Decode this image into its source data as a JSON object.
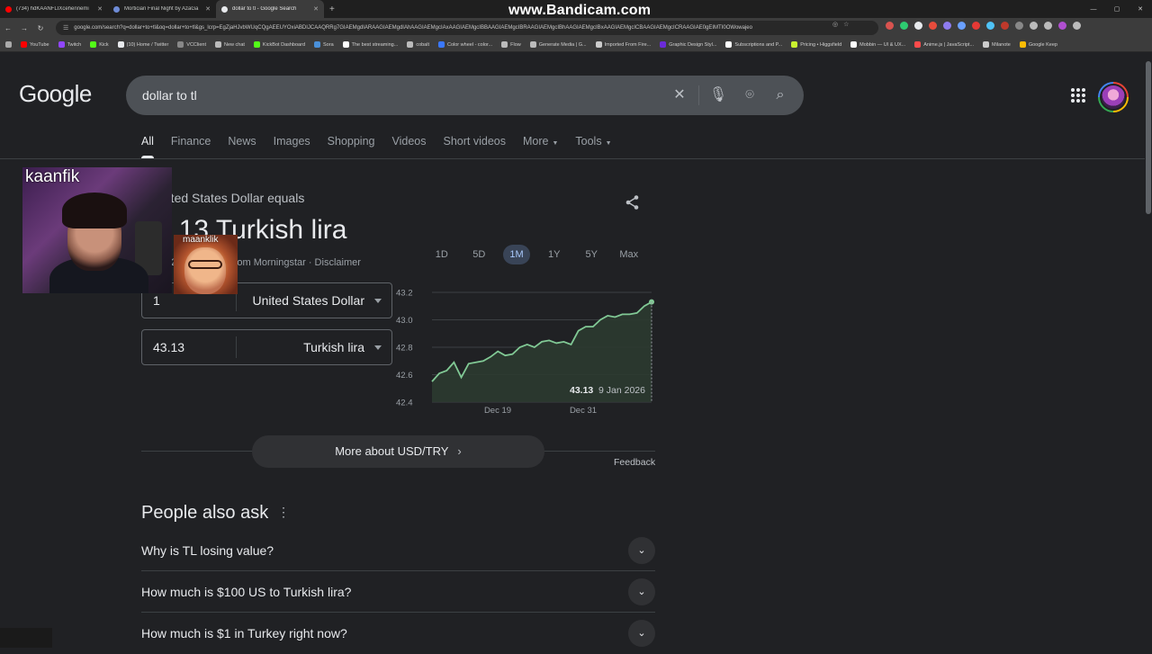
{
  "browser": {
    "tabs": [
      {
        "title": "(734) hdKAANFLIXcehennemi",
        "color": "#ff0000",
        "active": false
      },
      {
        "title": "Mortician Final Night by AzaGa",
        "color": "#6e8bd6",
        "active": false
      },
      {
        "title": "dollar to tl - Google Search",
        "color": "#e8eaed",
        "active": true
      }
    ],
    "new_tab": "+",
    "watermark": "www.Bandicam.com",
    "url": "google.com/search?q=dollar+to+tl&oq=dollar+to+tl&gs_lcrp=EgZjaHJvbWUqCQgAEEUYOxiABDIJCAAQRRg7GIAEMgdIARAAGIAEMgdIAhAAGIAEMgcIAxAAGIAEMgcIBBAAGIAEMgcIBRAAGIAEMgcIBhAAGIAEMgcIBxAAGIAEMgcICBAAGIAEMgcICRAAGIAE0gEIMTI0OWowajeo",
    "bookmarks": [
      {
        "label": "YouTube",
        "color": "#ff0000"
      },
      {
        "label": "Twitch",
        "color": "#9146ff"
      },
      {
        "label": "Kick",
        "color": "#53fc18"
      },
      {
        "label": "(10) Home / Twitter",
        "color": "#e8eaed"
      },
      {
        "label": "VCClient",
        "color": "#888888"
      },
      {
        "label": "New chat",
        "color": "#bbbbbb"
      },
      {
        "label": "KickBot Dashboard",
        "color": "#53fc18"
      },
      {
        "label": "Sora",
        "color": "#4a90d9"
      },
      {
        "label": "The best streaming...",
        "color": "#ffffff"
      },
      {
        "label": "cobalt",
        "color": "#bbbbbb"
      },
      {
        "label": "Color wheel - color...",
        "color": "#3a78ff"
      },
      {
        "label": "Flow",
        "color": "#bbbbbb"
      },
      {
        "label": "Generate Media | G...",
        "color": "#bbbbbb"
      },
      {
        "label": "Imported From Fire...",
        "color": "#cccccc"
      },
      {
        "label": "Graphic Design Styl...",
        "color": "#6b2bd9"
      },
      {
        "label": "Subscriptions and P...",
        "color": "#ffffff"
      },
      {
        "label": "Pricing • Higgsfield",
        "color": "#c9f22f"
      },
      {
        "label": "Mobbin — UI & UX...",
        "color": "#ffffff"
      },
      {
        "label": "Anime.js | JavaScript...",
        "color": "#ff4b4b"
      },
      {
        "label": "Milanote",
        "color": "#cccccc"
      },
      {
        "label": "Google Keep",
        "color": "#fbbc05"
      }
    ]
  },
  "google": {
    "logo": "Google",
    "query": "dollar to tl",
    "tabs": [
      {
        "label": "All",
        "active": true
      },
      {
        "label": "Finance"
      },
      {
        "label": "News"
      },
      {
        "label": "Images"
      },
      {
        "label": "Shopping"
      },
      {
        "label": "Videos"
      },
      {
        "label": "Short videos"
      },
      {
        "label": "More",
        "caret": true
      },
      {
        "label": "Tools",
        "caret": true
      }
    ]
  },
  "converter": {
    "equals_text": "1 United States Dollar equals",
    "result_text": "43.13 Turkish lira",
    "source_text": "9 Jan, 22:59 UTC · From Morningstar · Disclaimer",
    "from_amount": "1",
    "from_currency": "United States Dollar",
    "to_amount": "43.13",
    "to_currency": "Turkish lira",
    "ranges": [
      "1D",
      "5D",
      "1M",
      "1Y",
      "5Y",
      "Max"
    ],
    "selected_range": "1M",
    "more_label": "More about USD/TRY",
    "feedback_label": "Feedback"
  },
  "chart_data": {
    "type": "area",
    "title": "",
    "xlabel": "",
    "ylabel": "",
    "ylim": [
      42.4,
      43.2
    ],
    "yticks": [
      "43.2",
      "43.0",
      "42.8",
      "42.6",
      "42.4"
    ],
    "xtick_labels": [
      "Dec 19",
      "Dec 31"
    ],
    "series": [
      {
        "values": [
          42.55,
          42.61,
          42.63,
          42.69,
          42.58,
          42.68,
          42.69,
          42.7,
          42.73,
          42.77,
          42.74,
          42.75,
          42.8,
          42.82,
          42.8,
          42.84,
          42.85,
          42.83,
          42.84,
          42.82,
          42.92,
          42.95,
          42.95,
          43.0,
          43.03,
          43.02,
          43.04,
          43.04,
          43.05,
          43.1,
          43.13
        ]
      }
    ],
    "color": "#81c995",
    "fill": "#2b3a30",
    "tooltip": {
      "value": "43.13",
      "date": "9 Jan 2026"
    }
  },
  "paa": {
    "title": "People also ask",
    "questions": [
      "Why is TL losing value?",
      "How much is $100 US to Turkish lira?",
      "How much is $1 in Turkey right now?"
    ]
  },
  "overlays": {
    "cam_label": "kaanfik",
    "cam2_label": "maanklik"
  }
}
